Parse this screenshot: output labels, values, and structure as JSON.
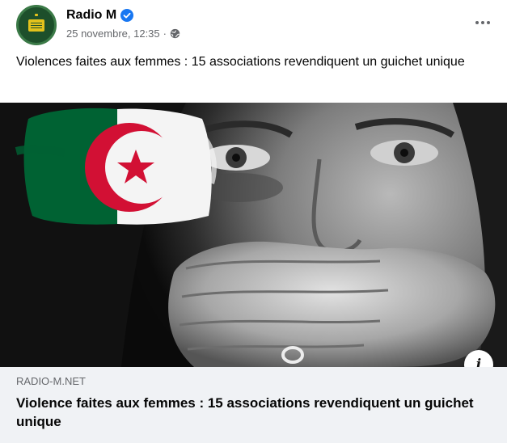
{
  "post": {
    "page_name": "Radio M",
    "verified_icon": "verified-badge-icon",
    "timestamp": "25 novembre, 12:35",
    "separator": "·",
    "audience_icon": "globe-icon",
    "more_icon": "more-options-icon",
    "text": "Violences faites aux femmes : 15 associations revendiquent un guichet unique"
  },
  "link_preview": {
    "domain": "RADIO-M.NET",
    "title": "Violence faites aux femmes : 15 associations revendiquent un guichet unique",
    "info_label": "i"
  },
  "colors": {
    "verified": "#1877f2",
    "flag_green": "#006233",
    "flag_red": "#d21034",
    "link_bg": "#f0f2f5",
    "meta_text": "#65676b"
  }
}
